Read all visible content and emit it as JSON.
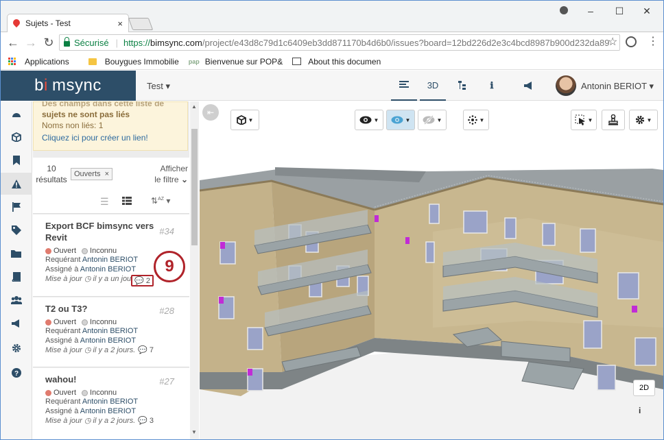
{
  "browser": {
    "tab_title": "Sujets - Test",
    "tab_close": "×",
    "win_minimize": "–",
    "win_maximize": "☐",
    "win_close": "✕",
    "back": "←",
    "forward": "→",
    "reload": "↻",
    "secure_label": "Sécurisé",
    "url_scheme": "https://",
    "url_host": "bimsync.com",
    "url_path": "/project/e43d8c79d1c6409eb3dd871170b4d6b0/issues?board=12bd226d2e3c4bcd8987b900d232da89",
    "star": "☆",
    "menu": "⋮",
    "bookmarks": [
      "Applications",
      "Bouygues Immobilie",
      "Bienvenue sur POP&",
      "About this documen"
    ],
    "pap_mark": "pap"
  },
  "app": {
    "logo_pre": "b",
    "logo_dot": "i",
    "logo_post": "msync",
    "project": "Test ▾",
    "nav": [
      "3D"
    ],
    "user": "Antonin BERIOT ▾"
  },
  "rail_icons": [
    "dashboard-icon",
    "cube-icon",
    "bookmark-icon",
    "warning-icon",
    "flag-icon",
    "tags-icon",
    "folder-icon",
    "book-icon",
    "users-icon",
    "megaphone-icon",
    "gear-icon",
    "help-icon"
  ],
  "notice": {
    "title_cut": "Des champs dans cette liste de",
    "title": "sujets ne sont pas liés",
    "unlinked": "Noms non liés: 1",
    "link": "Cliquez ici pour créer un lien!"
  },
  "filters": {
    "count": "10",
    "results_label": "résultats",
    "chip": "Ouverts",
    "chip_x": "×",
    "show_line1": "Afficher",
    "show_line2": "le filtre"
  },
  "issues": [
    {
      "title": "Export BCF bimsync vers Revit",
      "number": "#34",
      "status": "Ouvert",
      "priority": "Inconnu",
      "requester_label": "Requérant",
      "requester": "Antonin BERIOT",
      "assignee_label": "Assigné à",
      "assignee": "Antonin BERIOT",
      "updated_label": "Mise à jour",
      "updated": "il y a un jour.",
      "comments": "2"
    },
    {
      "title": "T2 ou T3?",
      "number": "#28",
      "status": "Ouvert",
      "priority": "Inconnu",
      "requester_label": "Requérant",
      "requester": "Antonin BERIOT",
      "assignee_label": "Assigné à",
      "assignee": "Antonin BERIOT",
      "updated_label": "Mise à jour",
      "updated": "il y a 2 jours.",
      "comments": "7"
    },
    {
      "title": "wahou!",
      "number": "#27",
      "status": "Ouvert",
      "priority": "Inconnu",
      "requester_label": "Requérant",
      "requester": "Antonin BERIOT",
      "assignee_label": "Assigné à",
      "assignee": "Antonin BERIOT",
      "updated_label": "Mise à jour",
      "updated": "il y a 2 jours.",
      "comments": "3"
    }
  ],
  "callout": "9",
  "viewer": {
    "btn_2d": "2D",
    "btn_info": "i"
  }
}
